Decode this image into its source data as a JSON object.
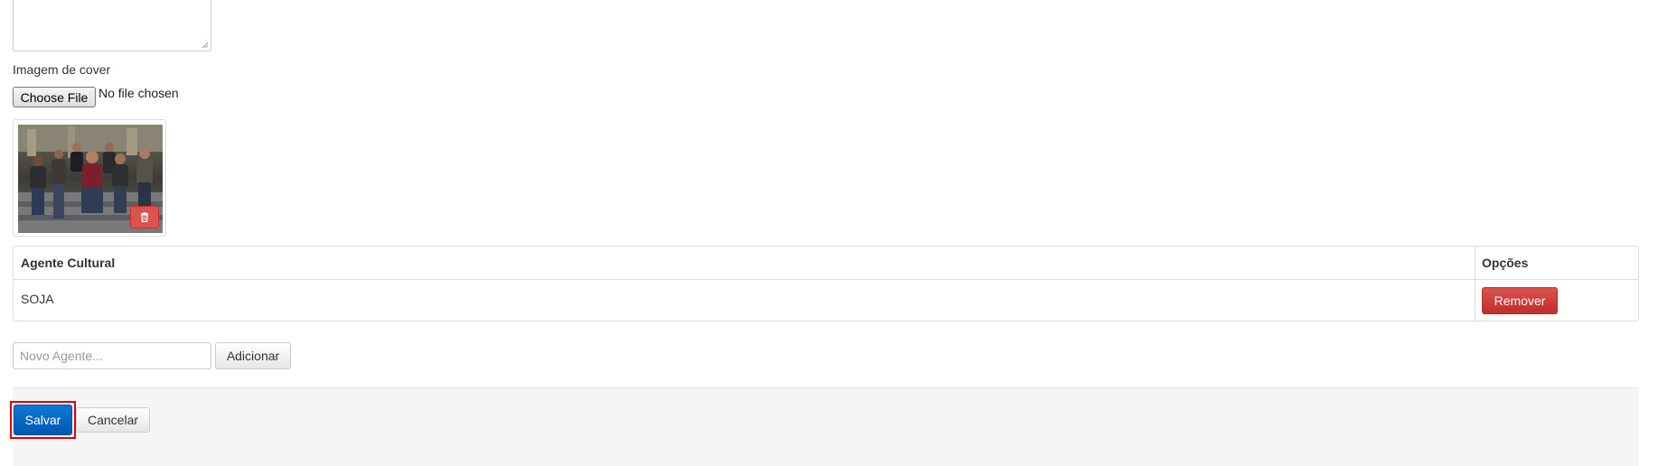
{
  "form": {
    "cover_label": "Imagem de cover",
    "file_button_label": "Choose File",
    "file_status": "No file chosen"
  },
  "agents_table": {
    "headers": [
      "Agente Cultural",
      "Opções"
    ],
    "rows": [
      {
        "agent": "SOJA",
        "action": "Remover"
      }
    ]
  },
  "new_agent": {
    "placeholder": "Novo Agente...",
    "add_label": "Adicionar"
  },
  "footer": {
    "save_label": "Salvar",
    "cancel_label": "Cancelar"
  },
  "colors": {
    "primary": "#0a78d8",
    "danger": "#d9534f",
    "highlight": "#e00000"
  },
  "icons": {
    "delete_image": "trash-icon"
  }
}
